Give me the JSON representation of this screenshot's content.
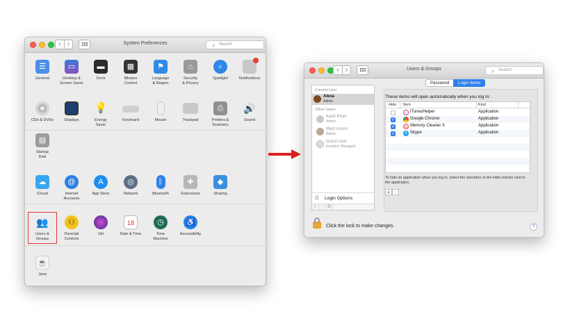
{
  "system_preferences": {
    "title": "System Preferences",
    "search_placeholder": "Search",
    "row1": [
      {
        "label": "General",
        "icon": "general-icon"
      },
      {
        "label": "Desktop &\nScreen Saver",
        "icon": "desktop-icon"
      },
      {
        "label": "Dock",
        "icon": "dock-icon"
      },
      {
        "label": "Mission\nControl",
        "icon": "mission-control-icon"
      },
      {
        "label": "Language\n& Region",
        "icon": "flag-icon"
      },
      {
        "label": "Security\n& Privacy",
        "icon": "house-icon"
      },
      {
        "label": "Spotlight",
        "icon": "spotlight-icon"
      },
      {
        "label": "Notifications",
        "icon": "notifications-icon"
      }
    ],
    "row2": [
      {
        "label": "CDs & DVDs",
        "icon": "disc-icon"
      },
      {
        "label": "Displays",
        "icon": "display-icon"
      },
      {
        "label": "Energy\nSaver",
        "icon": "bulb-icon"
      },
      {
        "label": "Keyboard",
        "icon": "keyboard-icon"
      },
      {
        "label": "Mouse",
        "icon": "mouse-icon"
      },
      {
        "label": "Trackpad",
        "icon": "trackpad-icon"
      },
      {
        "label": "Printers &\nScanners",
        "icon": "printer-icon"
      },
      {
        "label": "Sound",
        "icon": "speaker-icon"
      },
      {
        "label": "Startup\nDisk",
        "icon": "disk-icon"
      }
    ],
    "row3": [
      {
        "label": "iCloud",
        "icon": "cloud-icon"
      },
      {
        "label": "Internet\nAccounts",
        "icon": "at-icon"
      },
      {
        "label": "App Store",
        "icon": "app-store-icon"
      },
      {
        "label": "Network",
        "icon": "globe-icon"
      },
      {
        "label": "Bluetooth",
        "icon": "bluetooth-icon"
      },
      {
        "label": "Extensions",
        "icon": "puzzle-icon"
      },
      {
        "label": "Sharing",
        "icon": "sharing-icon"
      }
    ],
    "row4": [
      {
        "label": "Users &\nGroups",
        "icon": "users-icon",
        "selected": true
      },
      {
        "label": "Parental\nControls",
        "icon": "parental-icon"
      },
      {
        "label": "Siri",
        "icon": "siri-icon"
      },
      {
        "label": "Date & Time",
        "icon": "calendar-icon"
      },
      {
        "label": "Time\nMachine",
        "icon": "time-machine-icon"
      },
      {
        "label": "Accessibility",
        "icon": "accessibility-icon"
      }
    ],
    "row5": [
      {
        "label": "Java",
        "icon": "java-icon"
      }
    ]
  },
  "users_groups": {
    "title": "Users & Groups",
    "search_placeholder": "Search",
    "sidebar": {
      "current_user_header": "Current User",
      "current_user": {
        "name": "Alexa",
        "role": "Admin"
      },
      "other_users_header": "Other Users",
      "other_users": [
        {
          "name": "Karin Khan",
          "role": "Admin"
        },
        {
          "name": "Mark Anson",
          "role": "Admin"
        },
        {
          "name": "Guest User",
          "role": "Enabled, Managed"
        }
      ],
      "login_options": "Login Options"
    },
    "tabs": [
      "Password",
      "Login Items"
    ],
    "active_tab": "Login Items",
    "intro": "These items will open automatically when you log in:",
    "columns": {
      "hide": "Hide",
      "item": "Item",
      "kind": "Kind"
    },
    "items": [
      {
        "hide": false,
        "name": "iTunesHelper",
        "kind": "Application",
        "icon": "itunes-icon"
      },
      {
        "hide": true,
        "name": "Google Chrome",
        "kind": "Application",
        "icon": "chrome-icon"
      },
      {
        "hide": true,
        "name": "Memory Cleaner X",
        "kind": "Application",
        "icon": "memory-cleaner-icon"
      },
      {
        "hide": true,
        "name": "Skype",
        "kind": "Application",
        "icon": "skype-icon"
      }
    ],
    "hint": "To hide an application when you log in, select the checkbox in the Hide column next to the application.",
    "add_symbol": "+",
    "remove_symbol": "−",
    "lock_text": "Click the lock to make changes.",
    "help_symbol": "?"
  },
  "colors": {
    "selection": "#e03a3a",
    "arrow": "#e02020",
    "accent": "#2f7fed"
  }
}
